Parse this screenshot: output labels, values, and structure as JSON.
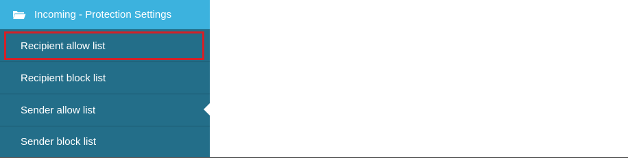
{
  "sidebar": {
    "section": {
      "title": "Incoming - Protection Settings",
      "icon": "folder-open-icon",
      "color": "#3cb2de"
    },
    "background_color": "#236e89",
    "items": [
      {
        "label": "Recipient allow list",
        "highlighted": true
      },
      {
        "label": "Recipient block list"
      },
      {
        "label": "Sender allow list",
        "active": true
      },
      {
        "label": "Sender block list"
      }
    ],
    "highlight_color": "#d42027"
  }
}
